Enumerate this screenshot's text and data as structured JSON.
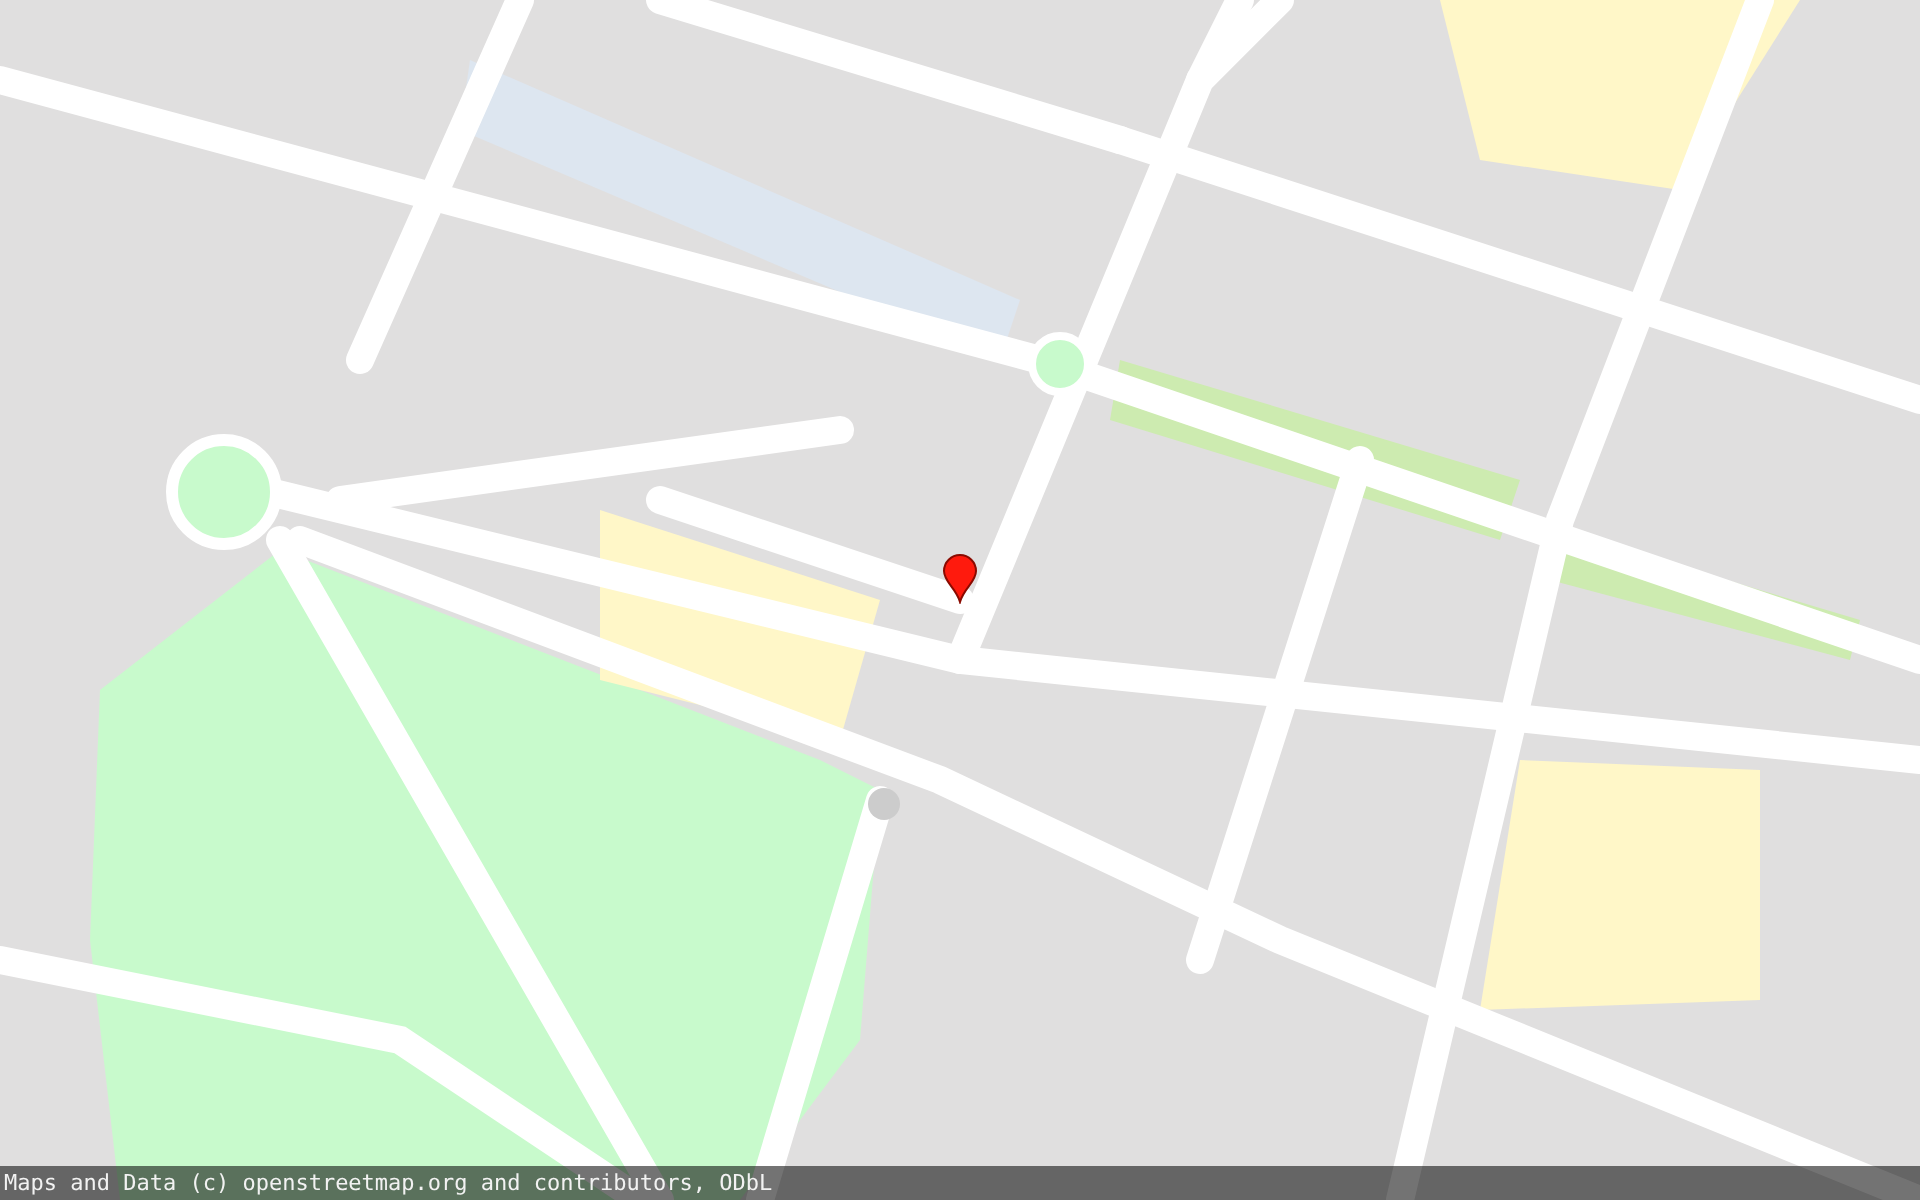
{
  "map": {
    "marker": {
      "visible": true
    }
  },
  "attribution": {
    "text": "Maps and Data (c) openstreetmap.org and contributors, ODbL"
  }
}
